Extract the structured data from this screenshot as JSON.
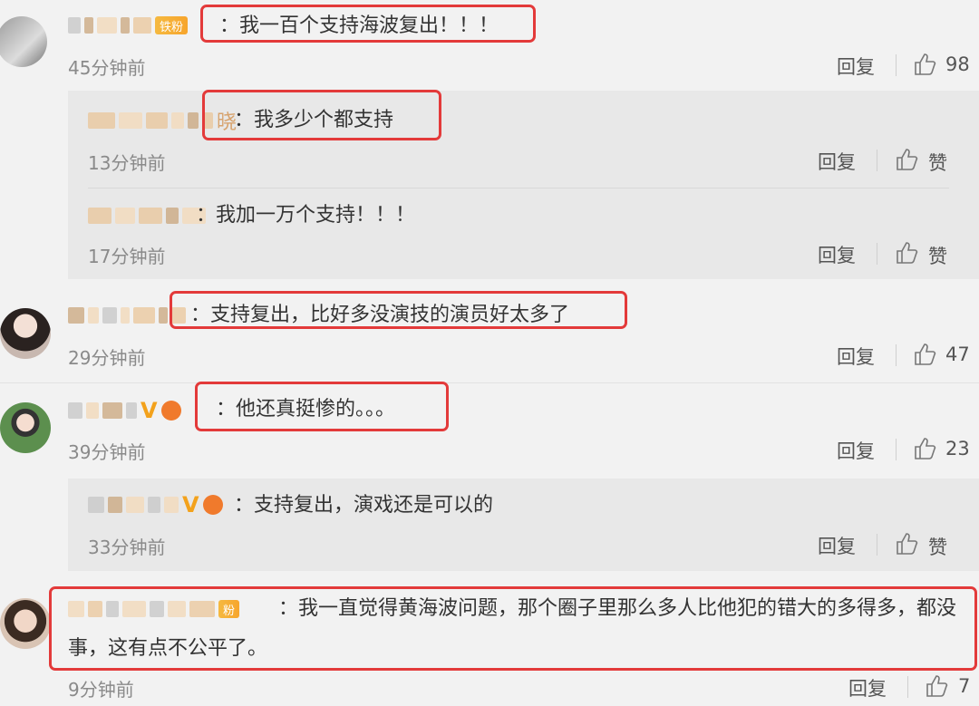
{
  "comments": [
    {
      "text": "：我一百个支持海波复出！！！",
      "time": "45分钟前",
      "reply_label": "回复",
      "likes": "98",
      "badge": "铁粉"
    },
    {
      "text": "：我多少个都支持",
      "time": "13分钟前",
      "reply_label": "回复",
      "likes": "赞",
      "name_tail": "晓"
    },
    {
      "text": "：我加一万个支持！！！",
      "time": "17分钟前",
      "reply_label": "回复",
      "likes": "赞"
    },
    {
      "text": "：支持复出，比好多没演技的演员好太多了",
      "time": "29分钟前",
      "reply_label": "回复",
      "likes": "47"
    },
    {
      "text": "：他还真挺惨的。。。",
      "time": "39分钟前",
      "reply_label": "回复",
      "likes": "23",
      "vip": "V"
    },
    {
      "text": "：支持复出，演戏还是可以的",
      "time": "33分钟前",
      "reply_label": "回复",
      "likes": "赞",
      "vip": "V"
    },
    {
      "text": "：我一直觉得黄海波问题，那个圈子里那么多人比他犯的错大的多得多，都没事，这有点不公平了。",
      "time": "9分钟前",
      "reply_label": "回复",
      "likes": "7",
      "badge": "粉"
    }
  ],
  "colors": {
    "highlight": "#e33a3a",
    "reply_bg": "#e8e8e8",
    "badge": "#f5b940"
  }
}
